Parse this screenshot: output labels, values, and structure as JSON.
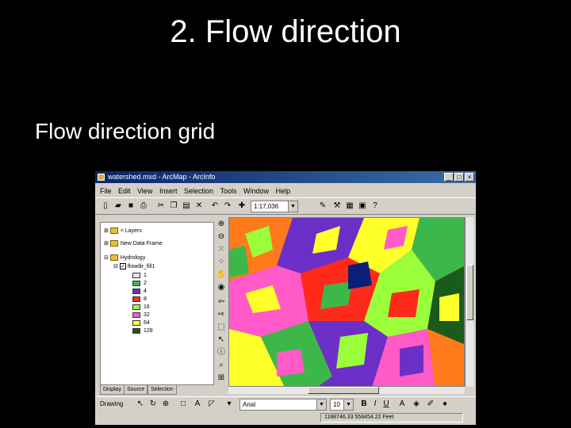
{
  "slide": {
    "title": "2. Flow direction",
    "subtitle": "Flow direction grid"
  },
  "window": {
    "title": "watershed.mxd - ArcMap - ArcInfo",
    "controls": [
      "_",
      "□",
      "×"
    ]
  },
  "menu": [
    "File",
    "Edit",
    "View",
    "Insert",
    "Selection",
    "Tools",
    "Window",
    "Help"
  ],
  "toolbar": {
    "scale_value": "1:17,036"
  },
  "toc": {
    "items": [
      {
        "label": "< Layers",
        "indent": 0
      },
      {
        "label": "New Data Frame",
        "indent": 0
      },
      {
        "label": "Hydrology",
        "indent": 0
      },
      {
        "label": "flowdir_fill1",
        "indent": 1
      }
    ],
    "legend": [
      {
        "value": "1",
        "color": "#e8e8e8"
      },
      {
        "value": "2",
        "color": "#3cb84a"
      },
      {
        "value": "4",
        "color": "#6b2fc8"
      },
      {
        "value": "8",
        "color": "#ff2a1a"
      },
      {
        "value": "16",
        "color": "#9aff3a"
      },
      {
        "value": "32",
        "color": "#ff5ac8"
      },
      {
        "value": "64",
        "color": "#ffff2a"
      },
      {
        "value": "128",
        "color": "#1a5a1a"
      }
    ],
    "tabs": [
      "Display",
      "Source",
      "Selection"
    ]
  },
  "drawing": {
    "label": "Drawing",
    "font_value": "Arial",
    "size_value": "10"
  },
  "status": {
    "coords": "1188746.33 558454.22 Feet"
  },
  "colors": {
    "ocean": "#0a1e7a",
    "green": "#3cb84a",
    "purple": "#6b2fc8",
    "red": "#ff2a1a",
    "lime": "#9aff3a",
    "magenta": "#ff5ac8",
    "yellow": "#ffff2a",
    "darkgreen": "#1a5a1a",
    "orange": "#ff7a1a"
  }
}
